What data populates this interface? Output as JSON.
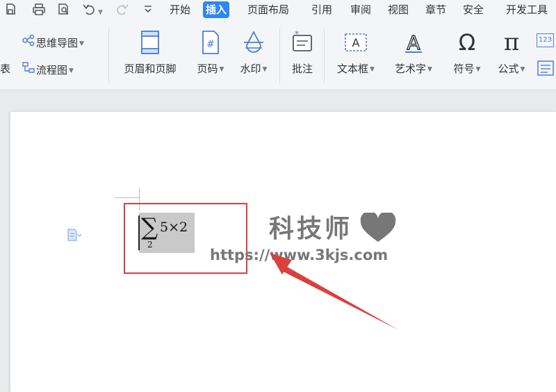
{
  "menubar": {
    "tabs": [
      "开始",
      "插入",
      "页面布局",
      "引用",
      "审阅",
      "视图",
      "章节",
      "安全",
      "开发工具"
    ],
    "active_tab": "插入"
  },
  "ribbon": {
    "left_partial_label": "表",
    "mindmap_label": "思维导图",
    "flowchart_label": "流程图",
    "header_footer_label": "页眉和页脚",
    "page_number_label": "页码",
    "watermark_label": "水印",
    "comment_label": "批注",
    "textbox_label": "文本框",
    "wordart_label": "艺术字",
    "symbol_label": "符号",
    "formula_label": "公式",
    "textbox_icon_text": "A",
    "wordart_icon_text": "A",
    "symbol_icon_text": "Ω",
    "formula_icon_text": "π",
    "page_number_icon_text": "#",
    "last_partial_icon_text": "123"
  },
  "document": {
    "equation": {
      "operator": "∑",
      "subscript": "2",
      "body": "5×2"
    },
    "watermark_text": "科技师",
    "watermark_url": "https://www.3kjs.com"
  },
  "colors": {
    "accent": "#2f86f6",
    "highlight_box": "#d9403e",
    "arrow": "#d9403e",
    "icon_blue": "#4a7fd6"
  }
}
